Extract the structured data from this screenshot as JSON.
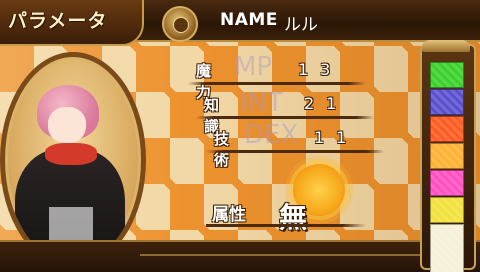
{
  "header": {
    "title": "パラメータ",
    "name_label": "NAME",
    "name_value": "ルル"
  },
  "stats": [
    {
      "label": "魔力",
      "value": "13",
      "ghost": "MP"
    },
    {
      "label": "知識",
      "value": "21",
      "ghost": "INT"
    },
    {
      "label": "技術",
      "value": "11",
      "ghost": "DEX"
    }
  ],
  "attribute": {
    "label": "属性",
    "value": "無",
    "orb_color": "#f7a81b"
  },
  "element_gauge": {
    "colors": [
      "#39d12a",
      "#5b4fd0",
      "#ff5a1f",
      "#ffb030",
      "#ff4fc0",
      "#f2e23a",
      "#f5f0d8"
    ]
  },
  "theme": {
    "accent": "#c69a4a",
    "dark": "#2a1606",
    "diamond": "#ec8e28"
  }
}
